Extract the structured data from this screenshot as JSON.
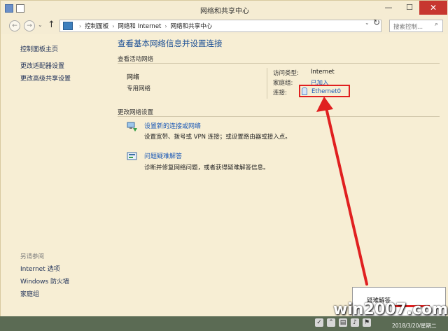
{
  "window": {
    "title": "网络和共享中心",
    "controls": {
      "minimize": "—",
      "maximize": "☐",
      "close": "✕"
    }
  },
  "address": {
    "back": "←",
    "forward": "→",
    "history": "⌄",
    "up": "↑",
    "breadcrumbs": [
      "控制面板",
      "网络和 Internet",
      "网络和共享中心"
    ],
    "separator": "›",
    "dropdown": "⌄",
    "refresh": "↻",
    "search_placeholder": "搜索控制..."
  },
  "sidebar": {
    "home": "控制面板主页",
    "links": [
      "更改适配器设置",
      "更改高级共享设置"
    ],
    "see_also_title": "另请参阅",
    "see_also": [
      "Internet 选项",
      "Windows 防火墙",
      "家庭组"
    ]
  },
  "main": {
    "title": "查看基本网络信息并设置连接",
    "active_section": "查看活动网络",
    "network": {
      "name": "网络",
      "type": "专用网络"
    },
    "info": [
      {
        "label": "访问类型:",
        "value": "Internet"
      },
      {
        "label": "家庭组:",
        "value": "已加入"
      },
      {
        "label": "连接:",
        "value": "Ethernet0"
      }
    ],
    "change_section": "更改网络设置",
    "tasks": [
      {
        "link": "设置新的连接或网络",
        "desc": "设置宽带、拨号或 VPN 连接；或设置路由器或接入点。"
      },
      {
        "link": "问题疑难解答",
        "desc": "诊断并修复网络问题，或者获得疑难解答信息。"
      }
    ]
  },
  "popup": {
    "item": "疑难解答"
  },
  "taskbar": {
    "clock": "2018/3/20/星期二"
  },
  "watermark": "win2007.com",
  "colors": {
    "link": "#1a58b6",
    "highlight": "#e02020",
    "title": "#1a4e95"
  }
}
